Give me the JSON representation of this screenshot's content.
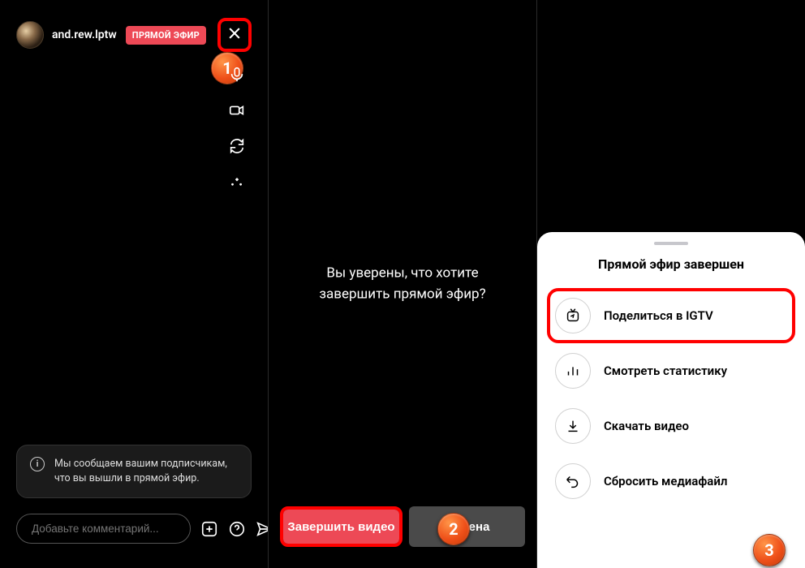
{
  "panel1": {
    "username": "and.rew.lptw",
    "live_badge": "ПРЯМОЙ ЭФИР",
    "notice": "Мы сообщаем вашим подписчикам, что вы вышли в прямой эфир.",
    "comment_placeholder": "Добавьте комментарий..."
  },
  "panel2": {
    "confirm_text": "Вы уверены, что хотите завершить прямой эфир?",
    "end_label": "Завершить видео",
    "cancel_label": "Отмена"
  },
  "panel3": {
    "sheet_title": "Прямой эфир завершен",
    "items": [
      {
        "label": "Поделиться в IGTV"
      },
      {
        "label": "Смотреть статистику"
      },
      {
        "label": "Скачать видео"
      },
      {
        "label": "Сбросить медиафайл"
      }
    ]
  },
  "steps": {
    "s1": "1",
    "s2": "2",
    "s3": "3"
  }
}
